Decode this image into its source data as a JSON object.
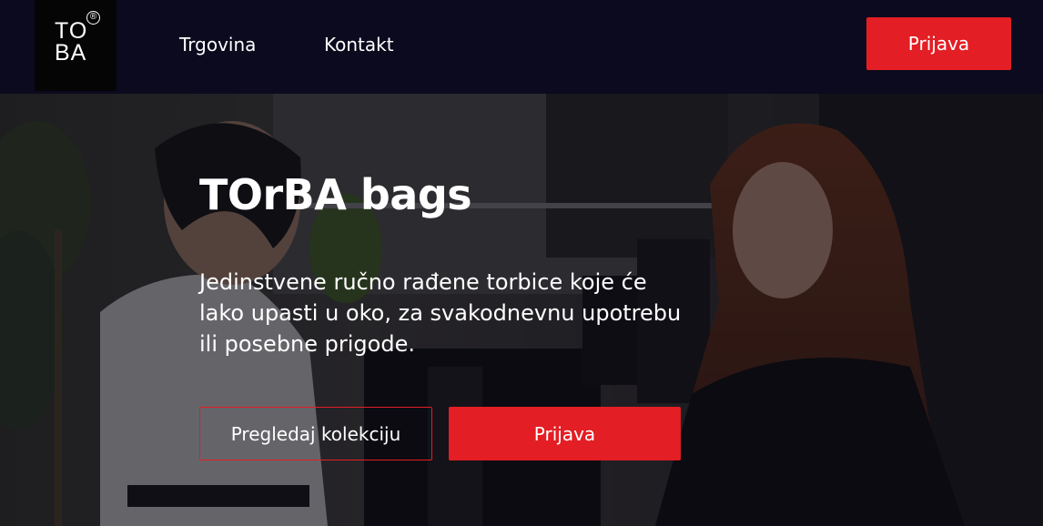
{
  "brand": {
    "logo_line1": "TO",
    "logo_line2": "BA",
    "logo_mark": "®"
  },
  "nav": {
    "links": [
      {
        "label": "Trgovina"
      },
      {
        "label": "Kontakt"
      }
    ],
    "login_label": "Prijava"
  },
  "hero": {
    "title": "TOrBA bags",
    "text": "Jedinstvene ručno rađene torbice koje će lako upasti u oko, za svakodnevnu upotrebu ili posebne prigode.",
    "secondary_button": "Pregledaj kolekciju",
    "primary_button": "Prijava"
  },
  "colors": {
    "accent": "#e31e24",
    "nav_bg": "#0b0a1e"
  }
}
